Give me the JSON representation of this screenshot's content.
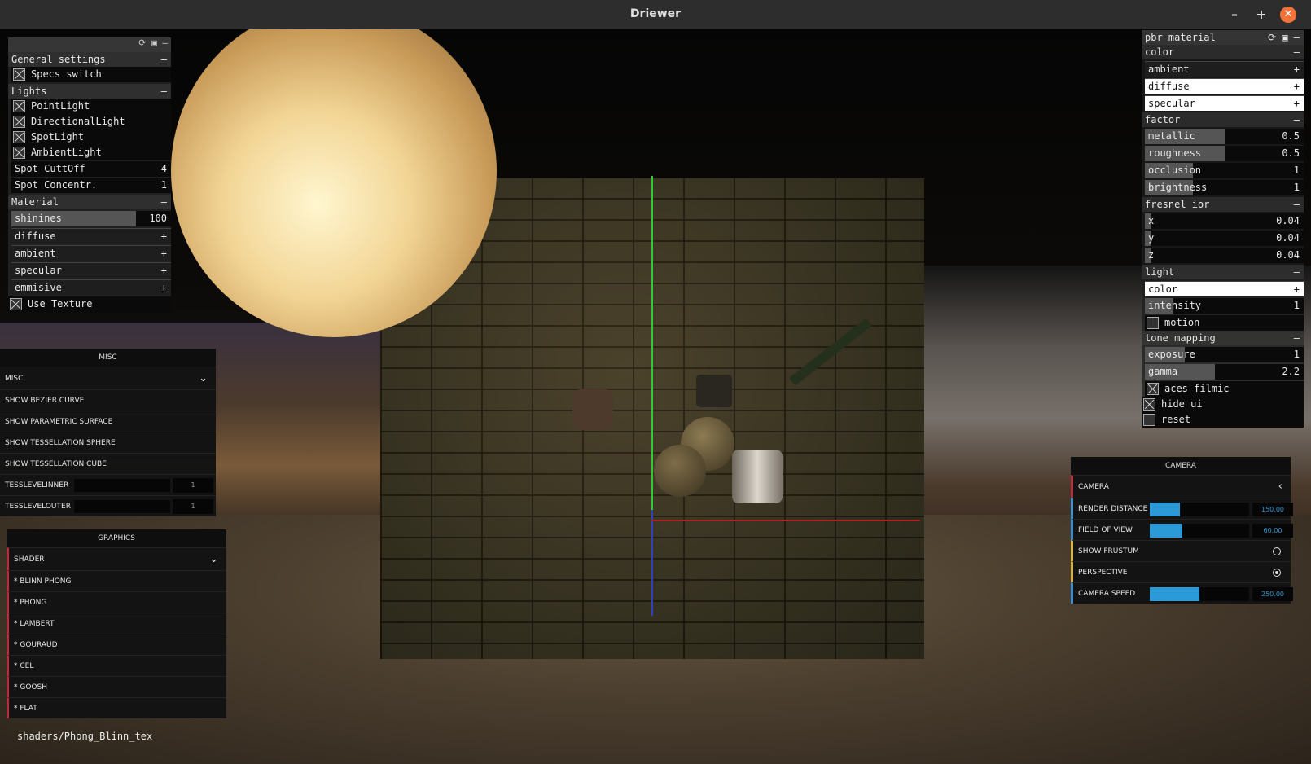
{
  "window": {
    "title": "Driewer",
    "minimize": "–",
    "maximize": "+",
    "close": "✕"
  },
  "left_gui": {
    "top_icons": "⟳ ▣ –",
    "general": {
      "label": "General settings",
      "toggle": "–",
      "specs": "Specs switch"
    },
    "lights": {
      "label": "Lights",
      "toggle": "–",
      "items": [
        "PointLight",
        "DirectionalLight",
        "SpotLight",
        "AmbientLight"
      ],
      "cutoff": {
        "label": "Spot CuttOff",
        "value": "4"
      },
      "concentr": {
        "label": "Spot Concentr.",
        "value": "1"
      }
    },
    "material": {
      "label": "Material",
      "toggle": "–",
      "shininess": {
        "label": "shinines",
        "value": "100",
        "fill": 0.78
      },
      "colors": [
        {
          "label": "diffuse",
          "plus": "+"
        },
        {
          "label": "ambient",
          "plus": "+"
        },
        {
          "label": "specular",
          "plus": "+"
        },
        {
          "label": "emmisive",
          "plus": "+"
        }
      ],
      "use_texture": "Use Texture"
    }
  },
  "misc": {
    "header": "MISC",
    "dropdown": "MISC",
    "buttons": [
      "SHOW BEZIER CURVE",
      "SHOW PARAMETRIC SURFACE",
      "SHOW TESSELLATION SPHERE",
      "SHOW TESSELLATION CUBE"
    ],
    "inner": {
      "label": "TESSLEVELINNER",
      "value": "1"
    },
    "outer": {
      "label": "TESSLEVELOUTER",
      "value": "1"
    }
  },
  "graphics": {
    "header": "GRAPHICS",
    "dropdown": "SHADER",
    "shaders": [
      "* BLINN PHONG",
      "* PHONG",
      "* LAMBERT",
      "* GOURAUD",
      "* CEL",
      "* GOOSH",
      "* FLAT"
    ]
  },
  "shader_path": "shaders/Phong_Blinn_tex",
  "right_gui": {
    "title": "pbr material",
    "top_icons": "⟳ ▣ –",
    "color": {
      "label": "color",
      "toggle": "–",
      "items": [
        {
          "label": "ambient",
          "plus": "+"
        },
        {
          "label": "diffuse",
          "plus": "+"
        },
        {
          "label": "specular",
          "plus": "+"
        }
      ]
    },
    "factor": {
      "label": "factor",
      "toggle": "–",
      "items": [
        {
          "label": "metallic",
          "value": "0.5",
          "fill": 0.5
        },
        {
          "label": "roughness",
          "value": "0.5",
          "fill": 0.5
        },
        {
          "label": "occlusion",
          "value": "1",
          "fill": 0.3
        },
        {
          "label": "brightness",
          "value": "1",
          "fill": 0.3
        }
      ]
    },
    "fresnel": {
      "label": "fresnel ior",
      "toggle": "–",
      "items": [
        {
          "label": "x",
          "value": "0.04",
          "fill": 0.04
        },
        {
          "label": "y",
          "value": "0.04",
          "fill": 0.04
        },
        {
          "label": "z",
          "value": "0.04",
          "fill": 0.04
        }
      ]
    },
    "light": {
      "label": "light",
      "toggle": "–",
      "color": {
        "label": "color",
        "plus": "+"
      },
      "intensity": {
        "label": "intensity",
        "value": "1",
        "fill": 0.18
      },
      "motion": "motion"
    },
    "tone": {
      "label": "tone mapping",
      "toggle": "–",
      "exposure": {
        "label": "exposure",
        "value": "1",
        "fill": 0.25
      },
      "gamma": {
        "label": "gamma",
        "value": "2.2",
        "fill": 0.44
      },
      "aces": "aces filmic"
    },
    "hide_ui": "hide ui",
    "reset": "reset"
  },
  "camera": {
    "header": "CAMERA",
    "dropdown": "CAMERA",
    "render": {
      "label": "RENDER DISTANCE",
      "value": "150.00",
      "fill": 0.3
    },
    "fov": {
      "label": "FIELD OF VIEW",
      "value": "60.00",
      "fill": 0.33
    },
    "frustum": "SHOW FRUSTUM",
    "perspective": "PERSPECTIVE",
    "speed": {
      "label": "CAMERA SPEED",
      "value": "250.00",
      "fill": 0.5
    }
  }
}
